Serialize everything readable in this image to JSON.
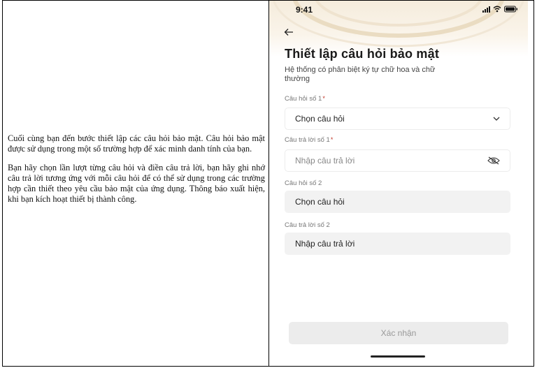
{
  "left_paragraphs": [
    "Cuối cùng bạn đến bước thiết lập các câu hỏi bảo mật. Câu hỏi bảo mật được sử dụng trong một số trường hợp để xác minh danh tính của bạn.",
    "Bạn hãy chọn lần lượt từng câu hỏi và điền câu trả lời, bạn hãy ghi nhớ câu trả lời tương ứng với mỗi câu hỏi để có thể sử dụng trong các trường hợp cần thiết theo yêu cầu bảo mật của ứng dụng. Thông báo xuất hiện, khi bạn kích hoạt thiết bị thành công."
  ],
  "phone": {
    "status_time": "9:41",
    "title": "Thiết lập câu hỏi bảo mật",
    "subtitle": "Hệ thống có phân biệt ký tự chữ hoa và chữ thường",
    "q1_label": "Câu hỏi số 1",
    "q1_value": "Chọn câu hỏi",
    "a1_label": "Câu trả lời số 1",
    "a1_placeholder": "Nhập câu trả lời",
    "q2_label": "Câu hỏi số 2",
    "q2_value": "Chọn câu hỏi",
    "a2_label": "Câu trả lời số 2",
    "a2_value": "Nhập câu trả lời",
    "required_mark": "*",
    "confirm_label": "Xác nhận"
  },
  "icons": [
    "back-arrow-icon",
    "chevron-down-icon",
    "eye-off-icon",
    "signal-icon",
    "wifi-icon",
    "battery-icon"
  ],
  "colors": {
    "required": "#c0392b",
    "header_tint": "#f5ecdc",
    "field_fill": "#f2f2f2"
  }
}
